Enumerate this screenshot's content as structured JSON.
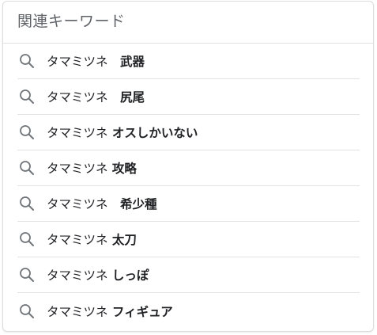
{
  "header": {
    "title": "関連キーワード"
  },
  "icons": {
    "search": "search-icon"
  },
  "colors": {
    "title": "#5f6368",
    "text": "#202124",
    "icon": "#70757a",
    "divider": "#e3e3e3"
  },
  "items": [
    {
      "base": "タマミツネ",
      "extra": "　武器"
    },
    {
      "base": "タマミツネ",
      "extra": "　尻尾"
    },
    {
      "base": "タマミツネ",
      "extra": " オスしかいない"
    },
    {
      "base": "タマミツネ",
      "extra": " 攻略"
    },
    {
      "base": "タマミツネ",
      "extra": "　希少種"
    },
    {
      "base": "タマミツネ",
      "extra": " 太刀"
    },
    {
      "base": "タマミツネ",
      "extra": " しっぽ"
    },
    {
      "base": "タマミツネ",
      "extra": " フィギュア"
    }
  ]
}
